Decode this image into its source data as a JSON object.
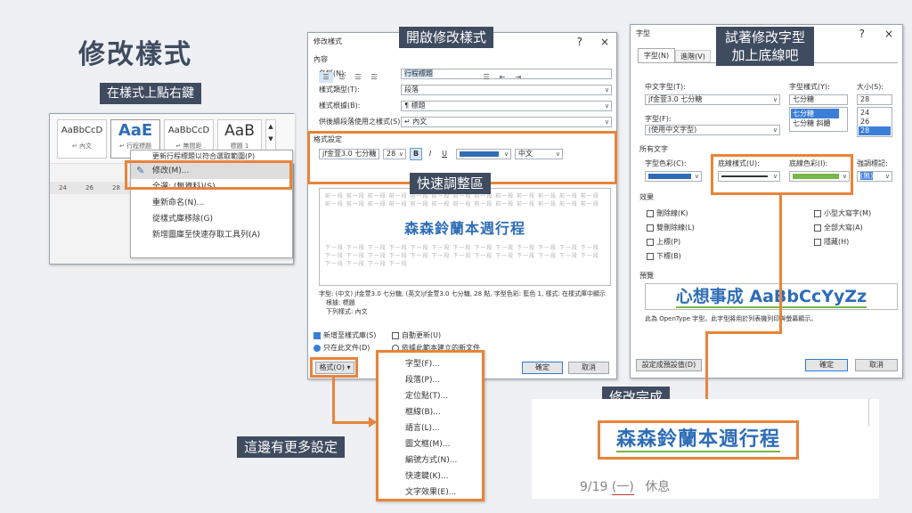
{
  "slide": {
    "title": "修改樣式",
    "label_right_click": "在樣式上點右鍵",
    "label_open": "開啟修改樣式",
    "label_quick": "快速調整區",
    "label_more": "這邊有更多設定",
    "label_font_line1": "試著修改字型",
    "label_font_line2": "加上底線吧",
    "label_done": "修改完成"
  },
  "ribbon": {
    "styles": [
      {
        "sample": "AaBbCcD",
        "name": "↵ 內文"
      },
      {
        "sample": "AaE",
        "name": "↵ 行程標題"
      },
      {
        "sample": "AaBbCcD",
        "name": "↵ 無間距"
      },
      {
        "sample": "AaB",
        "name": "標題 1"
      }
    ],
    "ruler": [
      "24",
      "26",
      "28"
    ],
    "context_menu": [
      "更新行程標題以符合選取範圍(P)",
      "修改(M)...",
      "全選: (無資料)(S)",
      "重新命名(N)...",
      "從樣式庫移除(G)",
      "新增圖庫至快速存取工具列(A)"
    ]
  },
  "modify_dialog": {
    "title": "修改樣式",
    "help": "?",
    "close": "×",
    "section_props": "內容",
    "props": [
      {
        "label": "名稱(N):",
        "value": "行程標題"
      },
      {
        "label": "樣式類型(T):",
        "value": "段落"
      },
      {
        "label": "樣式根據(B):",
        "value": "¶ 標題"
      },
      {
        "label": "供後續段落使用之樣式(S):",
        "value": "↵ 內文"
      }
    ],
    "section_format": "格式設定",
    "font_name": "jf金萱3.0 七分糖",
    "font_size": "28",
    "bold": "B",
    "italic": "I",
    "underline": "U",
    "lang": "中文",
    "ghost_prev": "前一段 前一段 前一段 前一段 前一段 前一段 前一段 前一段 前一段 前一段 前一段 前一段 前一段 前一段 前一段 前一段 前一段 前一段 前一段 前一段 前一段 前一段 前一段 前一段 前一段 前一段",
    "preview_text": "森森鈴蘭本週行程",
    "ghost_next": "下一段 下一段 下一段 下一段 下一段 下一段 下一段 下一段 下一段 下一段 下一段 下一段 下一段 下一段 下一段 下一段 下一段 下一段 下一段 下一段 下一段 下一段 下一段 下一段 下一段 下一段 下一段 下一段 下一段 下一段",
    "desc_1": "字型: (中文) jf金萱3.0 七分糖, (英文)jf金萱3.0 七分糖, 28 點, 字型色彩: 藍色 1, 樣式: 在樣式庫中顯示",
    "desc_2": "根據: 標題",
    "desc_3": "下列樣式: 內文",
    "add_gallery": "新增至樣式庫(S)",
    "auto_update": "自動更新(U)",
    "only_doc": "只在此文件(D)",
    "new_docs": "依據此範本建立的新文件",
    "format_btn": "格式(O) ▾",
    "ok": "確定",
    "cancel": "取消"
  },
  "format_menu": [
    "字型(F)...",
    "段落(P)...",
    "定位點(T)...",
    "框線(B)...",
    "語言(L)...",
    "圖文框(M)...",
    "編號方式(N)...",
    "快速鍵(K)...",
    "文字效果(E)..."
  ],
  "font_dialog": {
    "title": "字型",
    "help": "?",
    "close": "×",
    "tab_font": "字型(N)",
    "tab_adv": "進階(V)",
    "cn_font_label": "中文字型(T):",
    "cn_font_value": "jf金萱3.0 七分糖",
    "style_label": "字型樣式(Y):",
    "style_value": "七分糖",
    "style_list": [
      "七分糖",
      "七分糖 斜體"
    ],
    "size_label": "大小(S):",
    "size_value": "28",
    "size_list": [
      "24",
      "26",
      "28"
    ],
    "en_font_label": "字型(F):",
    "en_font_value": "(使用中文字型)",
    "all_text": "所有文字",
    "color_label": "字型色彩(C):",
    "ul_style_label": "底線樣式(U):",
    "ul_color_label": "底線色彩(I):",
    "emph_label": "強調標記:",
    "emph_value": "(無)",
    "effects_label": "效果",
    "effects_left": [
      "刪除線(K)",
      "雙刪除線(L)",
      "上標(P)",
      "下標(B)"
    ],
    "effects_right": [
      "小型大寫字(M)",
      "全部大寫(A)",
      "隱藏(H)"
    ],
    "preview_label": "預覽",
    "preview_text": "心想事成 AaBbCcYyZz",
    "preview_note": "此為 OpenType 字型。此字型將用於列表機列印與螢幕顯示。",
    "default_btn": "設定成預設值(D)",
    "ok": "確定",
    "cancel": "取消"
  },
  "result": {
    "title": "森森鈴蘭本週行程",
    "date": "9/19",
    "weekday": "(一)",
    "note": "休息"
  },
  "colors": {
    "accent_orange": "#e8843a",
    "label_bg": "#3f4b5f",
    "preview_blue": "#2e6db6",
    "underline_green": "#7ab648"
  }
}
